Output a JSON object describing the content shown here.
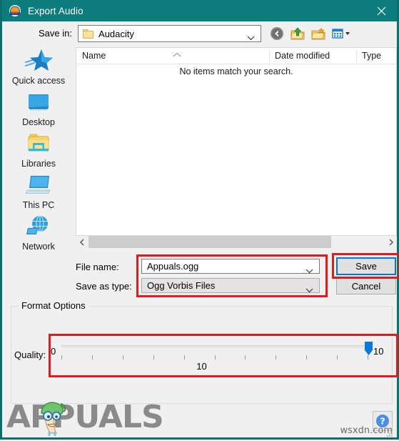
{
  "window": {
    "title": "Export Audio",
    "icon": "audacity-headphones-icon",
    "close_label": "✕",
    "titlebar_color": "#0d7c7c"
  },
  "savein": {
    "label": "Save in:",
    "value": "Audacity",
    "toolbar": [
      {
        "name": "back-icon",
        "tooltip": "Back"
      },
      {
        "name": "up-folder-icon",
        "tooltip": "Up one level"
      },
      {
        "name": "new-folder-icon",
        "tooltip": "Create New Folder"
      },
      {
        "name": "views-icon",
        "tooltip": "Views"
      }
    ]
  },
  "places": [
    {
      "label": "Quick access",
      "icon": "star-icon"
    },
    {
      "label": "Desktop",
      "icon": "monitor-icon"
    },
    {
      "label": "Libraries",
      "icon": "libraries-folder-icon"
    },
    {
      "label": "This PC",
      "icon": "computer-icon"
    },
    {
      "label": "Network",
      "icon": "globe-network-icon"
    }
  ],
  "filelist": {
    "columns": [
      "Name",
      "Date modified",
      "Type"
    ],
    "empty_message": "No items match your search.",
    "sort_indicator": "ascending-caret-icon",
    "rows": []
  },
  "filename": {
    "label": "File name:",
    "value": "Appuals.ogg"
  },
  "filetype": {
    "label": "Save as type:",
    "value": "Ogg Vorbis Files"
  },
  "buttons": {
    "save": "Save",
    "cancel": "Cancel"
  },
  "format_options": {
    "legend": "Format Options",
    "quality_label": "Quality:",
    "slider_min": "0",
    "slider_max": "10",
    "slider_value": "10",
    "tick_count": 11
  },
  "annotations": {
    "highlight_color": "#e01b1b",
    "boxes": [
      "filename-and-type-fields",
      "save-button",
      "quality-slider"
    ]
  },
  "branding": {
    "logo_text": "APPUALS",
    "watermark": "wsxdn.com",
    "help_label": "?"
  }
}
